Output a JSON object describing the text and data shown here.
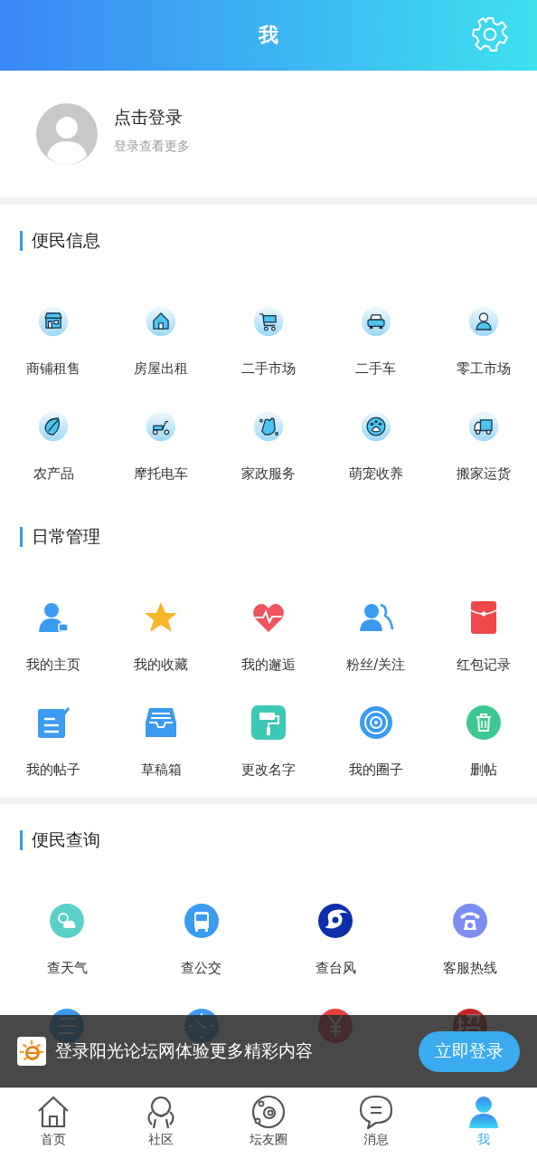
{
  "header": {
    "title": "我"
  },
  "profile": {
    "name": "点击登录",
    "hint": "登录查看更多"
  },
  "sections": [
    {
      "title": "便民信息",
      "items": [
        {
          "label": "商铺租售"
        },
        {
          "label": "房屋出租"
        },
        {
          "label": "二手市场"
        },
        {
          "label": "二手车"
        },
        {
          "label": "零工市场"
        },
        {
          "label": "农产品"
        },
        {
          "label": "摩托电车"
        },
        {
          "label": "家政服务"
        },
        {
          "label": "萌宠收养"
        },
        {
          "label": "搬家运货"
        }
      ]
    },
    {
      "title": "日常管理",
      "items": [
        {
          "label": "我的主页"
        },
        {
          "label": "我的收藏"
        },
        {
          "label": "我的邂逅"
        },
        {
          "label": "粉丝/关注"
        },
        {
          "label": "红包记录"
        },
        {
          "label": "我的帖子"
        },
        {
          "label": "草稿箱"
        },
        {
          "label": "更改名字"
        },
        {
          "label": "我的圈子"
        },
        {
          "label": "删帖"
        }
      ]
    },
    {
      "title": "便民查询",
      "items": [
        {
          "label": "查天气"
        },
        {
          "label": "查公交"
        },
        {
          "label": "查台风"
        },
        {
          "label": "客服热线"
        }
      ]
    }
  ],
  "login_banner": {
    "text": "登录阳光论坛网体验更多精彩内容",
    "button": "立即登录"
  },
  "tabs": [
    {
      "label": "首页",
      "selected": false
    },
    {
      "label": "社区",
      "selected": false
    },
    {
      "label": "坛友圈",
      "selected": false
    },
    {
      "label": "消息",
      "selected": false
    },
    {
      "label": "我",
      "selected": true
    }
  ]
}
